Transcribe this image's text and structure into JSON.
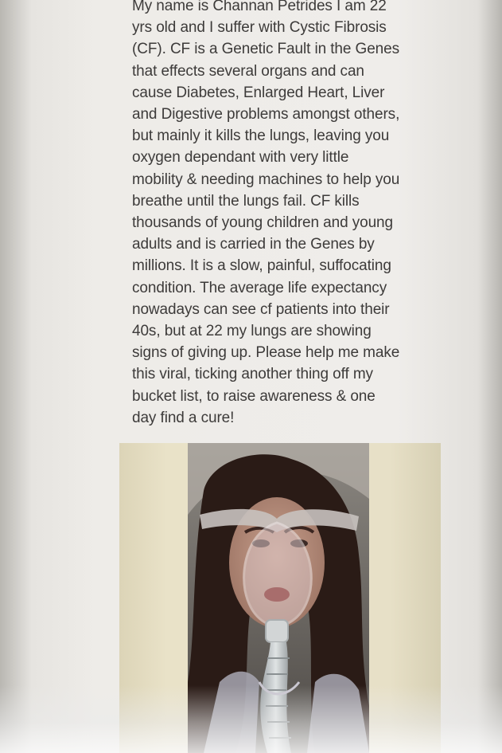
{
  "post": {
    "lines": [
      "My name is Channan Petrides I am 22",
      "yrs old and I suffer with Cystic Fibrosis",
      "(CF). CF is a Genetic Fault in the Genes",
      "that effects several organs and can",
      "cause Diabetes, Enlarged Heart, Liver",
      "and Digestive problems amongst others,",
      "but mainly it kills the lungs, leaving you",
      "oxygen dependant with very little",
      "mobility & needing machines to help you",
      "breathe until the lungs fail. CF kills",
      "thousands of young children and young",
      "adults and is carried in the Genes by",
      "millions. It is a slow, painful, suffocating",
      "condition. The average life expectancy",
      "nowadays can see cf patients into their",
      "40s, but at 22 my lungs are showing",
      "signs of giving up. Please help me make",
      "this viral, ticking another thing off my",
      "bucket list, to raise awareness & one",
      "day find a cure!"
    ]
  },
  "colors": {
    "text": "#3d3b3a",
    "page_background": "#efedea",
    "photo_border": "#e7e0c7"
  }
}
